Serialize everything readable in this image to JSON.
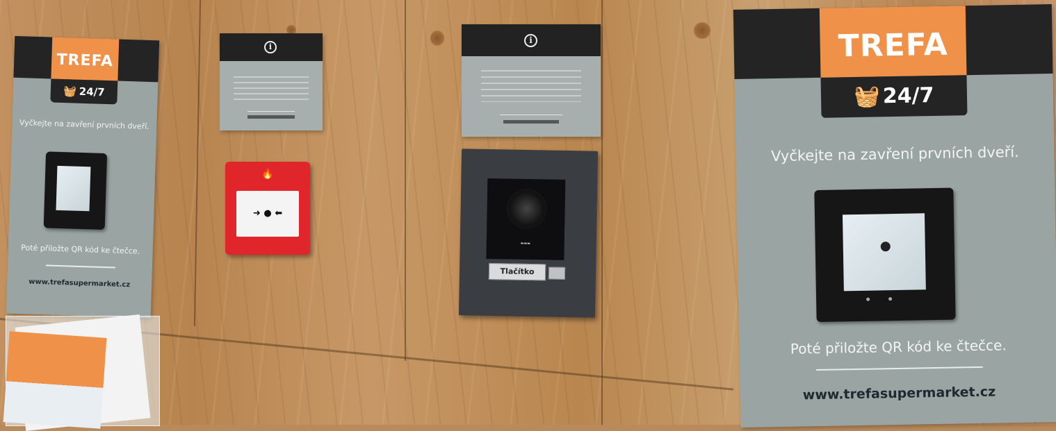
{
  "colors": {
    "brand_orange": "#f0914a",
    "poster_grey": "#9aa4a3",
    "dark": "#242424",
    "alarm_red": "#e1262b"
  },
  "poster_small": {
    "logo": "TREFA",
    "badge": "24/7",
    "icon": "basket-icon",
    "message_top": "Vyčkejte na zavření prvních dveří.",
    "message_bottom": "Poté přiložte QR kód ke čtečce.",
    "url": "www.trefasupermarket.cz"
  },
  "poster_large": {
    "logo": "TREFA",
    "badge": "24/7",
    "icon": "basket-icon",
    "message_top": "Vyčkejte na zavření prvních dveří.",
    "message_bottom": "Poté přiložte QR kód ke čtečce.",
    "url": "www.trefasupermarket.cz"
  },
  "info_sign_left": {
    "icon": "info-icon",
    "glyph": "i"
  },
  "info_sign_right": {
    "icon": "info-icon",
    "glyph": "i"
  },
  "fire_alarm": {
    "icon": "flame-icon",
    "glass_symbol": "➜ ● ⬅"
  },
  "intercom": {
    "button_label": "Tlačítko"
  }
}
